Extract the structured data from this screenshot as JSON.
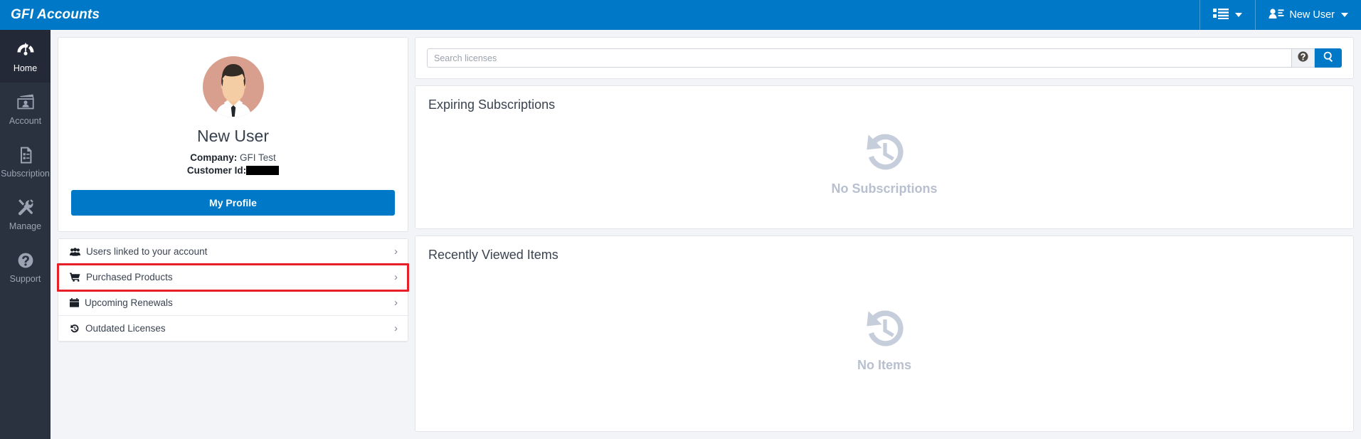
{
  "app": {
    "brand": "GFI Accounts"
  },
  "topbar": {
    "list_icon": "list-menu-icon",
    "user_icon": "user-card-icon",
    "user_label": "New User"
  },
  "sidebar": {
    "items": [
      {
        "label": "Home",
        "icon": "dashboard-gauge-icon",
        "active": true
      },
      {
        "label": "Account",
        "icon": "id-card-icon",
        "active": false
      },
      {
        "label": "Subscription",
        "icon": "document-list-icon",
        "active": false
      },
      {
        "label": "Manage",
        "icon": "tools-wrench-icon",
        "active": false
      },
      {
        "label": "Support",
        "icon": "question-circle-icon",
        "active": false
      }
    ]
  },
  "profile": {
    "name": "New User",
    "company_label": "Company:",
    "company_value": "GFI Test",
    "customer_id_label": "Customer Id:",
    "customer_id_value": "",
    "button_label": "My Profile",
    "avatar_icon": "user-avatar-illustration"
  },
  "quick_links": [
    {
      "label": "Users linked to your account",
      "icon": "users-group-icon",
      "chevron": "›",
      "highlighted": false
    },
    {
      "label": "Purchased Products",
      "icon": "shopping-cart-icon",
      "chevron": "›",
      "highlighted": true
    },
    {
      "label": "Upcoming Renewals",
      "icon": "calendar-icon",
      "chevron": "›",
      "highlighted": false
    },
    {
      "label": "Outdated Licenses",
      "icon": "history-clock-icon",
      "chevron": "›",
      "highlighted": false
    }
  ],
  "search": {
    "placeholder": "Search licenses",
    "value": "",
    "help_icon": "question-circle-icon",
    "search_icon": "magnifier-icon"
  },
  "panels": [
    {
      "title": "Expiring Subscriptions",
      "empty_text": "No Subscriptions",
      "empty_icon": "history-clock-icon"
    },
    {
      "title": "Recently Viewed Items",
      "empty_text": "No Items",
      "empty_icon": "history-clock-icon"
    }
  ],
  "colors": {
    "brand_blue": "#0078c8",
    "sidebar_dark": "#2b323f",
    "sidebar_active": "#232936",
    "highlight_red": "#e81f27",
    "empty_gray": "#c7cedb"
  }
}
